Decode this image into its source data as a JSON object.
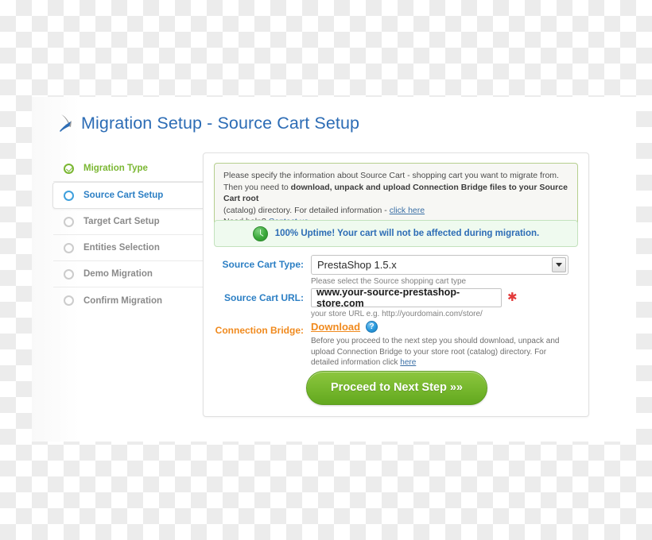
{
  "page": {
    "title": "Migration Setup - Source Cart Setup",
    "title_icon": "migration-arrow-icon"
  },
  "steps": [
    {
      "label": "Migration Type",
      "state": "done"
    },
    {
      "label": "Source Cart Setup",
      "state": "active"
    },
    {
      "label": "Target Cart Setup",
      "state": "pending"
    },
    {
      "label": "Entities Selection",
      "state": "pending"
    },
    {
      "label": "Demo Migration",
      "state": "pending"
    },
    {
      "label": "Confirm Migration",
      "state": "pending"
    }
  ],
  "info_box": {
    "line1": "Please specify the information about Source Cart - shopping cart you want to migrate from.",
    "line2_prefix": "Then you need to ",
    "line2_bold": "download, unpack and upload Connection Bridge files to your Source Cart root",
    "line3_prefix": "(catalog) directory. For detailed information - ",
    "line3_link": "click here",
    "line4_prefix": "Need help? ",
    "line4_link": "Contact us",
    "line4_suffix": "."
  },
  "uptime_banner": {
    "icon": "green-clock-icon",
    "text": "100% Uptime! Your cart will not be affected during migration."
  },
  "form": {
    "cart_type": {
      "label": "Source Cart Type:",
      "value": "PrestaShop 1.5.x",
      "hint": "Please select the Source shopping cart type",
      "arrow_icon": "chevron-down-icon"
    },
    "cart_url": {
      "label": "Source Cart URL:",
      "value": "www.your-source-prestashop-store.com",
      "placeholder": "www.your-source-prestashop-store.com",
      "required_mark": "✱",
      "hint": "your store URL e.g. http://yourdomain.com/store/"
    },
    "connection_bridge": {
      "label": "Connection Bridge:",
      "download_label": "Download",
      "help_icon": "help-question-icon",
      "help_glyph": "?",
      "hint_prefix": "Before you proceed to the next step you should download, unpack and upload Connection Bridge to your store root (catalog) directory. For detailed information click ",
      "hint_link": "here"
    }
  },
  "proceed_button": {
    "label": "Proceed to Next Step »»"
  },
  "colors": {
    "accent_blue": "#2c7fc4",
    "accent_green": "#7bb733",
    "accent_orange": "#f08a1e",
    "required_red": "#e33b3b",
    "button_green": "#77b82e"
  }
}
